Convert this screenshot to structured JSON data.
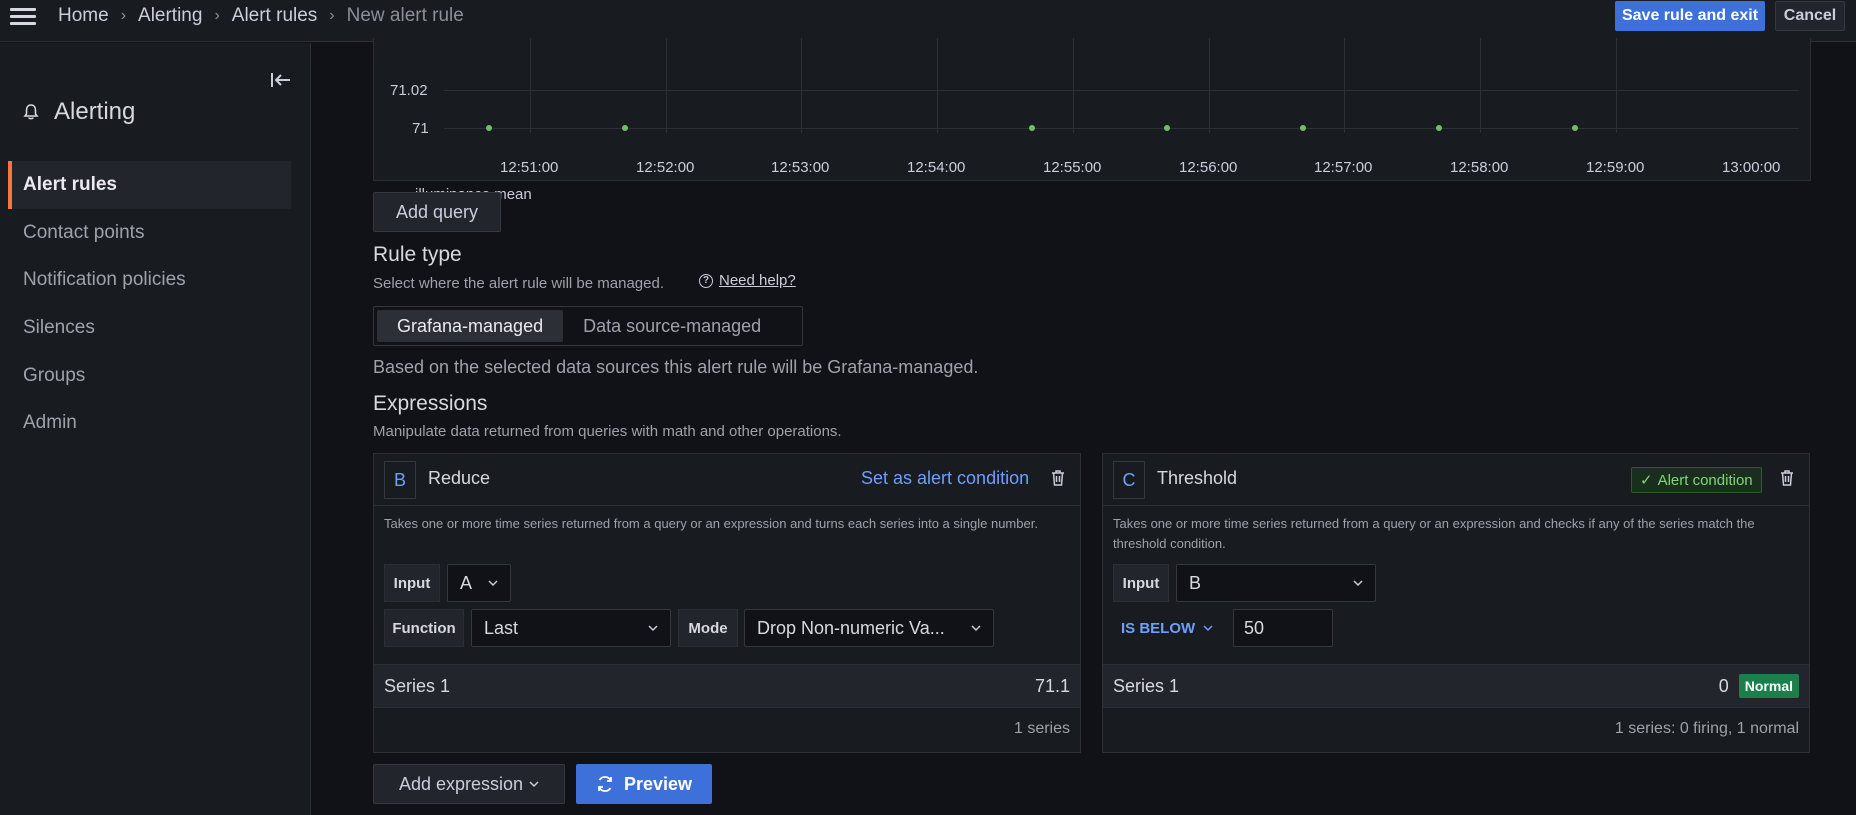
{
  "topbar": {
    "breadcrumbs": [
      "Home",
      "Alerting",
      "Alert rules",
      "New alert rule"
    ],
    "save_label": "Save rule and exit",
    "cancel_label": "Cancel"
  },
  "sidebar": {
    "title": "Alerting",
    "items": [
      {
        "label": "Alert rules",
        "active": true
      },
      {
        "label": "Contact points",
        "active": false
      },
      {
        "label": "Notification policies",
        "active": false
      },
      {
        "label": "Silences",
        "active": false
      },
      {
        "label": "Groups",
        "active": false
      },
      {
        "label": "Admin",
        "active": false
      }
    ]
  },
  "graph": {
    "y_ticks": [
      "71.02",
      "71"
    ],
    "x_ticks": [
      "12:51:00",
      "12:52:00",
      "12:53:00",
      "12:54:00",
      "12:55:00",
      "12:56:00",
      "12:57:00",
      "12:58:00",
      "12:59:00",
      "13:00:00"
    ],
    "legend": "illuminance.mean",
    "series_color": "#73bf69"
  },
  "chart_data": {
    "type": "scatter",
    "series": [
      {
        "name": "illuminance.mean",
        "x": [
          "12:50:35",
          "12:51:35",
          "12:54:35",
          "12:55:35",
          "12:56:35",
          "12:57:35",
          "12:58:35"
        ],
        "y": [
          71,
          71,
          71,
          71,
          71,
          71,
          71
        ]
      }
    ],
    "ylabel": "",
    "xlabel": ""
  },
  "add_query_label": "Add query",
  "rule_type": {
    "heading": "Rule type",
    "description": "Select where the alert rule will be managed.",
    "help_label": "Need help?",
    "options": [
      "Grafana-managed",
      "Data source-managed"
    ],
    "selected": "Grafana-managed",
    "info": "Based on the selected data sources this alert rule will be Grafana-managed."
  },
  "expressions": {
    "heading": "Expressions",
    "description": "Manipulate data returned from queries with math and other operations.",
    "cards": [
      {
        "ref": "B",
        "title": "Reduce",
        "action_label": "Set as alert condition",
        "desc": "Takes one or more time series returned from a query or an expression and turns each series into a single number.",
        "input_label": "Input",
        "input_value": "A",
        "function_label": "Function",
        "function_value": "Last",
        "mode_label": "Mode",
        "mode_value": "Drop Non-numeric Va...",
        "series_label": "Series 1",
        "series_value": "71.1",
        "footer": "1 series"
      },
      {
        "ref": "C",
        "title": "Threshold",
        "badge_label": "Alert condition",
        "desc": "Takes one or more time series returned from a query or an expression and checks if any of the series match the threshold condition.",
        "input_label": "Input",
        "input_value": "B",
        "op_label": "IS BELOW",
        "threshold_value": "50",
        "series_label": "Series 1",
        "series_value": "0",
        "status": "Normal",
        "footer": "1 series: 0 firing, 1 normal"
      }
    ]
  },
  "add_expression_label": "Add expression",
  "preview_label": "Preview"
}
